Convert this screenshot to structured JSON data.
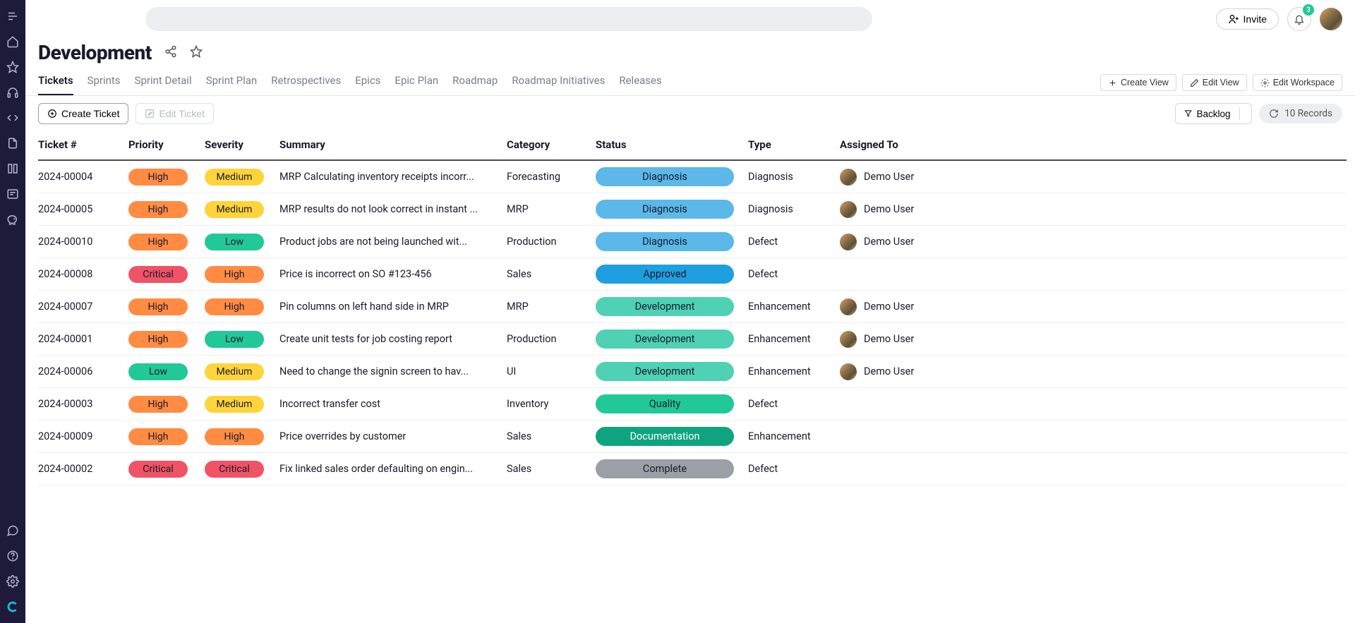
{
  "topbar": {
    "invite_label": "Invite",
    "notif_count": "3"
  },
  "page": {
    "title": "Development"
  },
  "tabs": [
    {
      "label": "Tickets",
      "active": true
    },
    {
      "label": "Sprints"
    },
    {
      "label": "Sprint Detail"
    },
    {
      "label": "Sprint Plan"
    },
    {
      "label": "Retrospectives"
    },
    {
      "label": "Epics"
    },
    {
      "label": "Epic Plan"
    },
    {
      "label": "Roadmap"
    },
    {
      "label": "Roadmap Initiatives"
    },
    {
      "label": "Releases"
    }
  ],
  "view_actions": {
    "create": "Create View",
    "edit_view": "Edit View",
    "edit_workspace": "Edit Workspace"
  },
  "toolbar": {
    "create_ticket": "Create Ticket",
    "edit_ticket": "Edit Ticket",
    "filter_label": "Backlog",
    "records_label": "10 Records"
  },
  "columns": {
    "ticket": "Ticket #",
    "priority": "Priority",
    "severity": "Severity",
    "summary": "Summary",
    "category": "Category",
    "status": "Status",
    "type": "Type",
    "assigned": "Assigned To"
  },
  "rows": [
    {
      "ticket": "2024-00004",
      "priority": "High",
      "severity": "Medium",
      "summary": "MRP Calculating inventory receipts incorr...",
      "category": "Forecasting",
      "status": "Diagnosis",
      "type": "Diagnosis",
      "assigned": "Demo User"
    },
    {
      "ticket": "2024-00005",
      "priority": "High",
      "severity": "Medium",
      "summary": "MRP results do not look correct in instant ...",
      "category": "MRP",
      "status": "Diagnosis",
      "type": "Diagnosis",
      "assigned": "Demo User"
    },
    {
      "ticket": "2024-00010",
      "priority": "High",
      "severity": "Low",
      "summary": "Product jobs are not being launched wit...",
      "category": "Production",
      "status": "Diagnosis",
      "type": "Defect",
      "assigned": "Demo User"
    },
    {
      "ticket": "2024-00008",
      "priority": "Critical",
      "severity": "High",
      "summary": "Price is incorrect on SO #123-456",
      "category": "Sales",
      "status": "Approved",
      "type": "Defect",
      "assigned": ""
    },
    {
      "ticket": "2024-00007",
      "priority": "High",
      "severity": "High",
      "summary": "Pin columns on left hand side in MRP",
      "category": "MRP",
      "status": "Development",
      "type": "Enhancement",
      "assigned": "Demo User"
    },
    {
      "ticket": "2024-00001",
      "priority": "High",
      "severity": "Low",
      "summary": "Create unit tests for job costing report",
      "category": "Production",
      "status": "Development",
      "type": "Enhancement",
      "assigned": "Demo User"
    },
    {
      "ticket": "2024-00006",
      "priority": "Low",
      "severity": "Medium",
      "summary": "Need to change the signin screen to hav...",
      "category": "UI",
      "status": "Development",
      "type": "Enhancement",
      "assigned": "Demo User"
    },
    {
      "ticket": "2024-00003",
      "priority": "High",
      "severity": "Medium",
      "summary": "Incorrect transfer cost",
      "category": "Inventory",
      "status": "Quality",
      "type": "Defect",
      "assigned": ""
    },
    {
      "ticket": "2024-00009",
      "priority": "High",
      "severity": "High",
      "summary": "Price overrides by customer",
      "category": "Sales",
      "status": "Documentation",
      "type": "Enhancement",
      "assigned": ""
    },
    {
      "ticket": "2024-00002",
      "priority": "Critical",
      "severity": "Critical",
      "summary": "Fix linked sales order defaulting on engin...",
      "category": "Sales",
      "status": "Complete",
      "type": "Defect",
      "assigned": ""
    }
  ]
}
